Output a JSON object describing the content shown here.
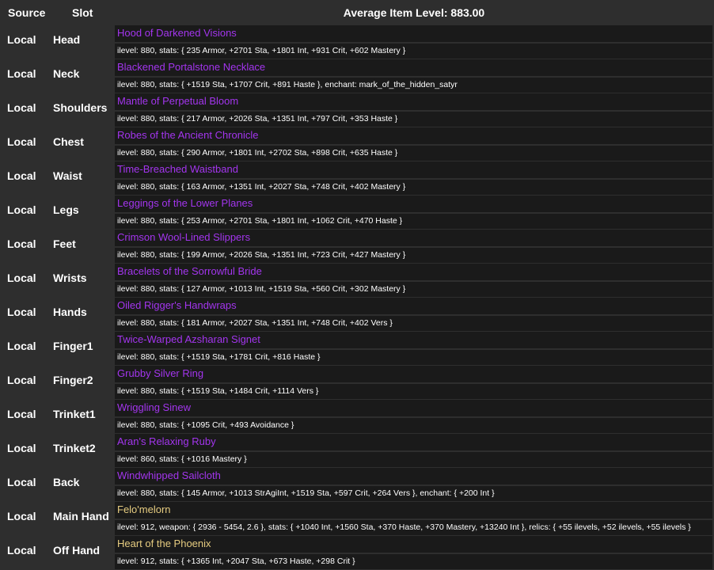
{
  "header": {
    "source_label": "Source",
    "slot_label": "Slot",
    "average_item_level": "Average Item Level: 883.00"
  },
  "colors": {
    "background": "#2e2e2e",
    "cell_background": "#1a1a1a",
    "epic_item": "#a335ee",
    "artifact_item": "#e6cc80",
    "text": "#ffffff"
  },
  "items": [
    {
      "source": "Local",
      "slot": "Head",
      "name": "Hood of Darkened Visions",
      "quality": "epic",
      "details": "ilevel: 880, stats: { 235 Armor, +2701 Sta, +1801 Int, +931 Crit, +602 Mastery }"
    },
    {
      "source": "Local",
      "slot": "Neck",
      "name": "Blackened Portalstone Necklace",
      "quality": "epic",
      "details": "ilevel: 880, stats: { +1519 Sta, +1707 Crit, +891 Haste }, enchant: mark_of_the_hidden_satyr"
    },
    {
      "source": "Local",
      "slot": "Shoulders",
      "name": "Mantle of Perpetual Bloom",
      "quality": "epic",
      "details": "ilevel: 880, stats: { 217 Armor, +2026 Sta, +1351 Int, +797 Crit, +353 Haste }"
    },
    {
      "source": "Local",
      "slot": "Chest",
      "name": "Robes of the Ancient Chronicle",
      "quality": "epic",
      "details": "ilevel: 880, stats: { 290 Armor, +1801 Int, +2702 Sta, +898 Crit, +635 Haste }"
    },
    {
      "source": "Local",
      "slot": "Waist",
      "name": "Time-Breached Waistband",
      "quality": "epic",
      "details": "ilevel: 880, stats: { 163 Armor, +1351 Int, +2027 Sta, +748 Crit, +402 Mastery }"
    },
    {
      "source": "Local",
      "slot": "Legs",
      "name": "Leggings of the Lower Planes",
      "quality": "epic",
      "details": "ilevel: 880, stats: { 253 Armor, +2701 Sta, +1801 Int, +1062 Crit, +470 Haste }"
    },
    {
      "source": "Local",
      "slot": "Feet",
      "name": "Crimson Wool-Lined Slippers",
      "quality": "epic",
      "details": "ilevel: 880, stats: { 199 Armor, +2026 Sta, +1351 Int, +723 Crit, +427 Mastery }"
    },
    {
      "source": "Local",
      "slot": "Wrists",
      "name": "Bracelets of the Sorrowful Bride",
      "quality": "epic",
      "details": "ilevel: 880, stats: { 127 Armor, +1013 Int, +1519 Sta, +560 Crit, +302 Mastery }"
    },
    {
      "source": "Local",
      "slot": "Hands",
      "name": "Oiled Rigger's Handwraps",
      "quality": "epic",
      "details": "ilevel: 880, stats: { 181 Armor, +2027 Sta, +1351 Int, +748 Crit, +402 Vers }"
    },
    {
      "source": "Local",
      "slot": "Finger1",
      "name": "Twice-Warped Azsharan Signet",
      "quality": "epic",
      "details": "ilevel: 880, stats: { +1519 Sta, +1781 Crit, +816 Haste }"
    },
    {
      "source": "Local",
      "slot": "Finger2",
      "name": "Grubby Silver Ring",
      "quality": "epic",
      "details": "ilevel: 880, stats: { +1519 Sta, +1484 Crit, +1114 Vers }"
    },
    {
      "source": "Local",
      "slot": "Trinket1",
      "name": "Wriggling Sinew",
      "quality": "epic",
      "details": "ilevel: 880, stats: { +1095 Crit, +493 Avoidance }"
    },
    {
      "source": "Local",
      "slot": "Trinket2",
      "name": "Aran's Relaxing Ruby",
      "quality": "epic",
      "details": "ilevel: 860, stats: { +1016 Mastery }"
    },
    {
      "source": "Local",
      "slot": "Back",
      "name": "Windwhipped Sailcloth",
      "quality": "epic",
      "details": "ilevel: 880, stats: { 145 Armor, +1013 StrAgiInt, +1519 Sta, +597 Crit, +264 Vers }, enchant: { +200 Int }"
    },
    {
      "source": "Local",
      "slot": "Main Hand",
      "name": "Felo'melorn",
      "quality": "artifact",
      "details": "ilevel: 912, weapon: { 2936 - 5454, 2.6 }, stats: { +1040 Int, +1560 Sta, +370 Haste, +370 Mastery, +13240 Int }, relics: { +55 ilevels, +52 ilevels, +55 ilevels }"
    },
    {
      "source": "Local",
      "slot": "Off Hand",
      "name": "Heart of the Phoenix",
      "quality": "artifact",
      "details": "ilevel: 912, stats: { +1365 Int, +2047 Sta, +673 Haste, +298 Crit }"
    }
  ]
}
